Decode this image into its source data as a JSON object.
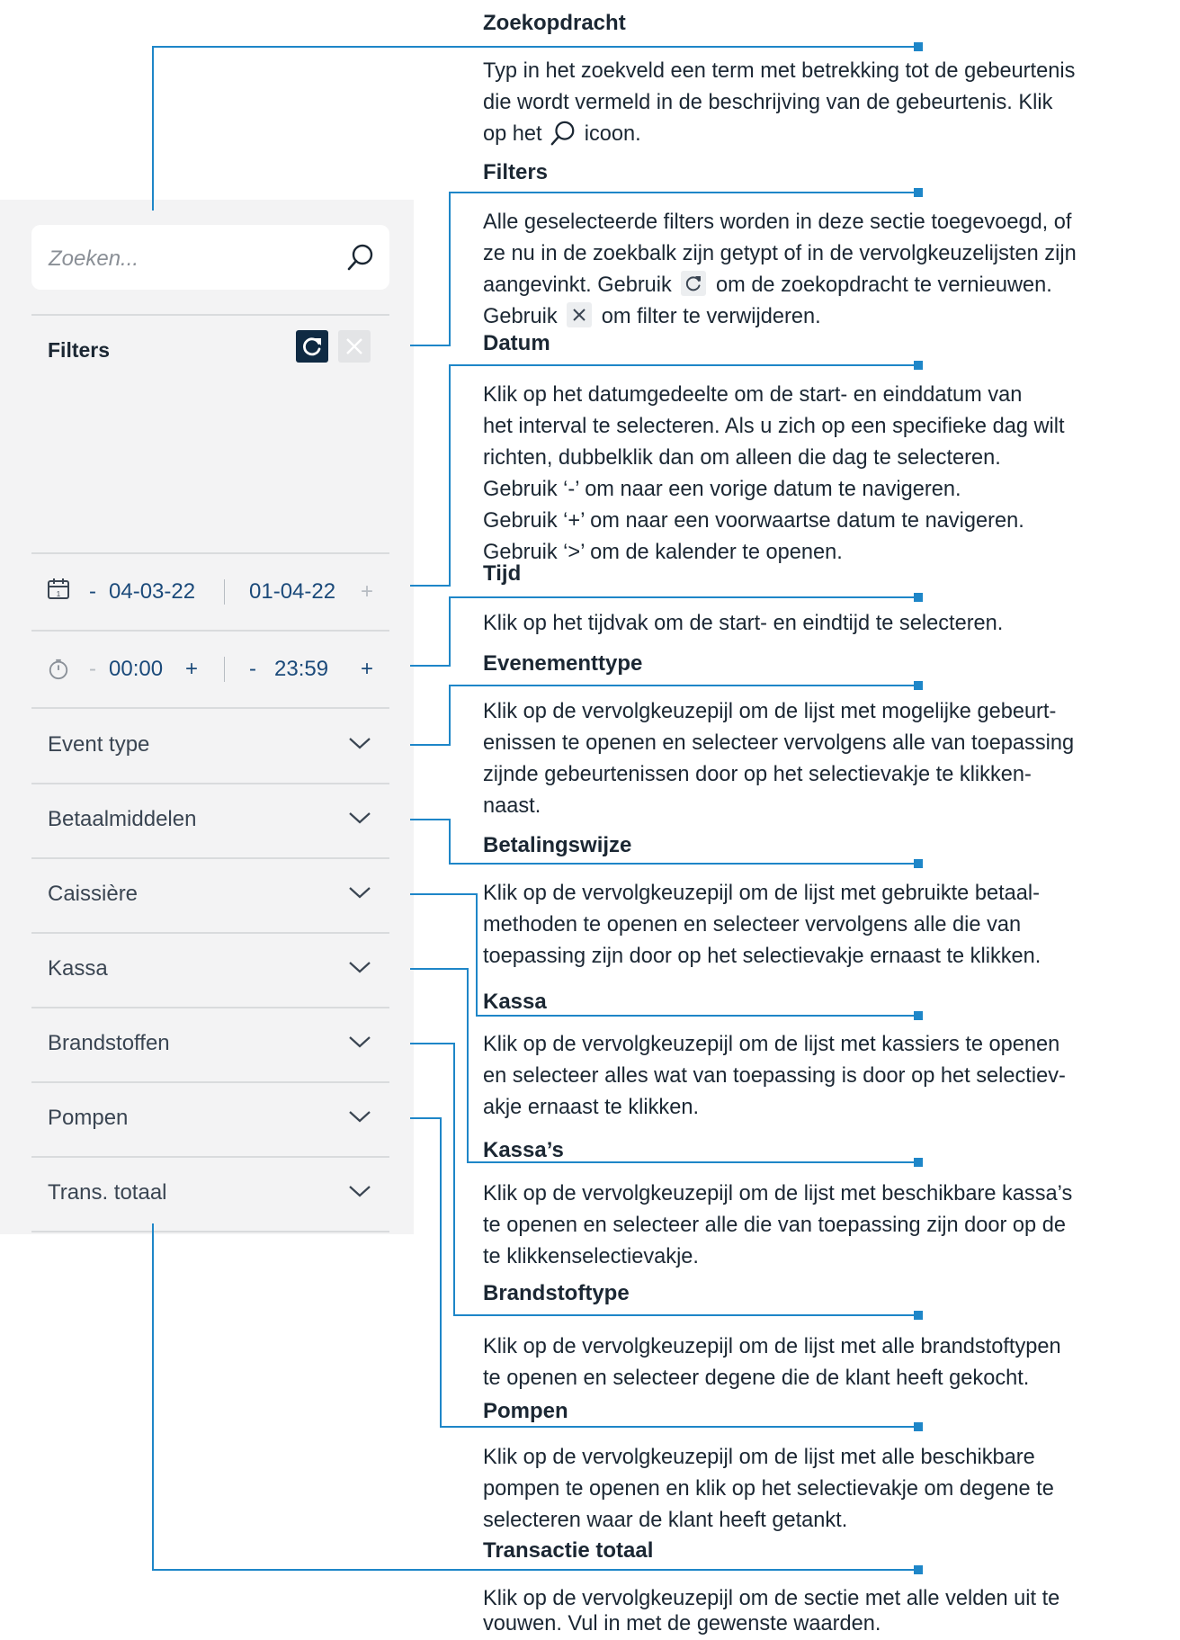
{
  "panel": {
    "search_placeholder": "Zoeken...",
    "filters_label": "Filters",
    "date": {
      "start": "04-03-22",
      "end": "01-04-22",
      "minus": "-",
      "plus": "+"
    },
    "time": {
      "start": "00:00",
      "end": "23:59",
      "minus": "-",
      "plus": "+"
    },
    "dropdowns": [
      "Event type",
      "Betaalmiddelen",
      "Caissière",
      "Kassa",
      "Brandstoffen",
      "Pompen",
      "Trans. totaal"
    ]
  },
  "annotations": [
    {
      "title": "Zoekopdracht",
      "lines": [
        "Typ in het zoekveld een term met betrekking tot de gebeurtenis",
        "die wordt vermeld in de beschrijving van de gebeurtenis. Klik"
      ],
      "line3_pre": "op het",
      "line3_post": "icoon."
    },
    {
      "title": "Filters",
      "lines": [
        "Alle geselecteerde filters worden in deze sectie toegevoegd, of",
        "ze nu in de zoekbalk zijn getypt of in de vervolgkeuzelijsten zijn"
      ],
      "line3_pre": "aangevinkt. Gebruik",
      "line3_post": "om de zoekopdracht te vernieuwen.",
      "line4_pre": "Gebruik",
      "line4_post": "om filter te verwijderen."
    },
    {
      "title": "Datum",
      "lines": [
        "Klik op het datumgedeelte om de start- en einddatum van",
        "het interval te selecteren. Als u zich op een specifieke dag wilt",
        "richten, dubbelklik dan om alleen die dag te selecteren.",
        "Gebruik ‘-’ om naar een vorige datum te navigeren.",
        "Gebruik ‘+’ om naar een voorwaartse datum te navigeren.",
        "Gebruik ‘>’ om de kalender te openen."
      ]
    },
    {
      "title": "Tijd",
      "lines": [
        "Klik op het tijdvak om de start- en eindtijd te selecteren."
      ]
    },
    {
      "title": "Evenementtype",
      "lines": [
        "Klik op de vervolgkeuzepijl om de lijst met mogelijke gebeurt-",
        "enissen te openen en selecteer vervolgens alle van toepassing",
        "zijnde gebeurtenissen door op het selectievakje te klikken-",
        "naast."
      ]
    },
    {
      "title": "Betalingswijze",
      "lines": [
        "Klik op de vervolgkeuzepijl om de lijst met gebruikte betaal-",
        "methoden te openen en selecteer vervolgens alle die van",
        "toepassing zijn door op het selectievakje ernaast te klikken."
      ]
    },
    {
      "title": "Kassa",
      "lines": [
        "Klik op de vervolgkeuzepijl om de lijst met kassiers te openen",
        "en selecteer alles wat van toepassing is door op het selectiev-",
        "akje ernaast te klikken."
      ]
    },
    {
      "title": "Kassa’s",
      "lines": [
        "Klik op de vervolgkeuzepijl om de lijst met beschikbare kassa’s",
        "te openen en selecteer alle die van toepassing zijn door op de",
        "te klikkenselectievakje."
      ]
    },
    {
      "title": "Brandstoftype",
      "lines": [
        "Klik op de vervolgkeuzepijl om de lijst met alle brandstoftypen",
        "te openen en selecteer degene die de klant heeft gekocht."
      ]
    },
    {
      "title": "Pompen",
      "lines": [
        "Klik op de vervolgkeuzepijl om de lijst met alle beschikbare",
        "pompen te openen en klik op het selectievakje om degene te",
        "selecteren waar de klant heeft getankt."
      ]
    },
    {
      "title": "Transactie totaal",
      "lines": [
        "Klik op de vervolgkeuzepijl om de sectie met alle velden uit te",
        "vouwen. Vul in met de gewenste waarden."
      ]
    }
  ],
  "colors": {
    "connector": "#1e86c8",
    "panel_bg": "#f3f3f4",
    "dark_button": "#0f2a43"
  },
  "icons": [
    "search-icon",
    "refresh-icon",
    "close-icon",
    "calendar-icon",
    "clock-icon",
    "chevron-down-icon"
  ]
}
